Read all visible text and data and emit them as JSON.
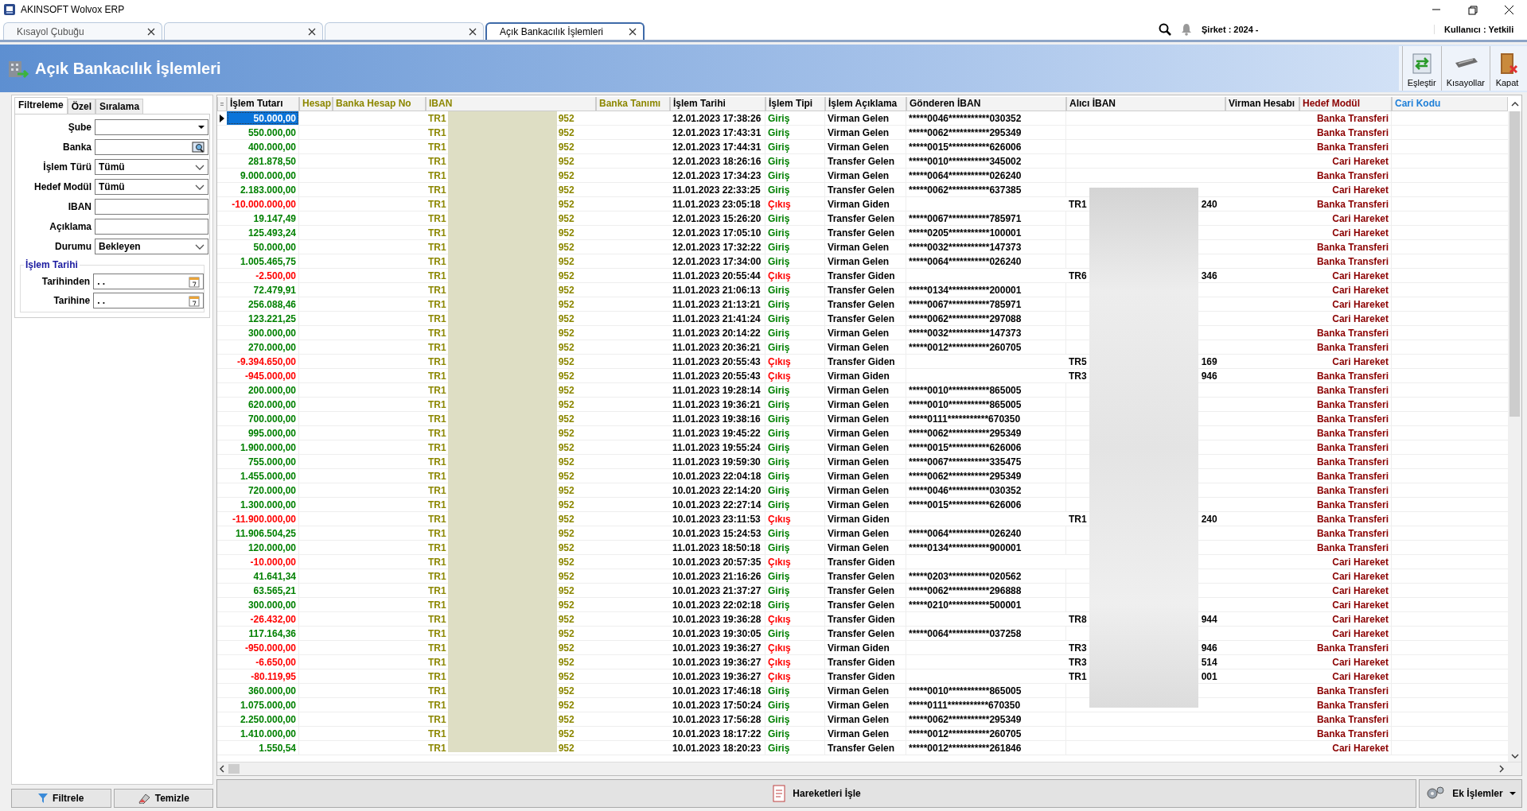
{
  "window": {
    "title": "AKINSOFT Wolvox ERP"
  },
  "tabs": [
    {
      "label": "Kısayol Çubuğu",
      "selected": false
    },
    {
      "selected": false
    },
    {
      "selected": false
    },
    {
      "label": "Açık Bankacılık İşlemleri",
      "selected": true
    }
  ],
  "status": {
    "company": "Şirket : 2024 -",
    "user": "Kullanıcı : Yetkili"
  },
  "page_title": "Açık Bankacılık İşlemleri",
  "toolbar": [
    {
      "label": "Eşleştir",
      "kind": "match"
    },
    {
      "label": "Kısayollar",
      "kind": "keyboard"
    },
    {
      "label": "Kapat",
      "kind": "exit"
    }
  ],
  "filter_tabs": [
    {
      "label": "Filtreleme",
      "selected": true
    },
    {
      "label": "Özel",
      "selected": false
    },
    {
      "label": "Sıralama",
      "selected": false
    }
  ],
  "filters": [
    {
      "label": "Şube",
      "kind": "dropdown"
    },
    {
      "label": "Banka",
      "kind": "lookup"
    },
    {
      "label": "İşlem Türü",
      "kind": "select",
      "value": "Tümü"
    },
    {
      "label": "Hedef Modül",
      "kind": "select",
      "value": "Tümü"
    },
    {
      "label": "IBAN",
      "kind": "text"
    },
    {
      "label": "Açıklama",
      "kind": "text"
    },
    {
      "label": "Durumu",
      "kind": "select",
      "value": "Bekleyen"
    }
  ],
  "date_group": {
    "title": "İşlem Tarihi",
    "fields": [
      {
        "label": "Tarihinden",
        "value": ". ."
      },
      {
        "label": "Tarihine",
        "value": ". ."
      }
    ]
  },
  "filter_buttons": [
    {
      "label": "Filtrele",
      "kind": "filter"
    },
    {
      "label": "Temizle",
      "kind": "clear"
    }
  ],
  "table": {
    "columns": [
      {
        "title": "İşlem Tutarı",
        "color": "#000000"
      },
      {
        "title": "Hesap",
        "color": "#8c8700"
      },
      {
        "title": "Banka Hesap No",
        "color": "#8c8700"
      },
      {
        "title": "IBAN",
        "color": "#8c8700"
      },
      {
        "title": "Banka Tanımı",
        "color": "#8c8700"
      },
      {
        "title": "İşlem Tarihi",
        "color": "#000000"
      },
      {
        "title": "İşlem Tipi",
        "color": "#000000"
      },
      {
        "title": "İşlem Açıklama",
        "color": "#000000"
      },
      {
        "title": "Gönderen İBAN",
        "color": "#000000"
      },
      {
        "title": "Alıcı İBAN",
        "color": "#000000"
      },
      {
        "title": "Virman Hesabı",
        "color": "#000000"
      },
      {
        "title": "Hedef Modül",
        "color": "#8b0000"
      },
      {
        "title": "Cari Kodu",
        "color": "#1e7fd8"
      }
    ],
    "rows": [
      {
        "amount": "50.000,00",
        "kind": "in",
        "selected": true,
        "iban": {
          "start": "TR1",
          "end": "952"
        },
        "date": "12.01.2023 17:38:26",
        "type": "Giriş",
        "desc": "Virman Gelen",
        "sender": "*****0046***********030352",
        "target": "Banka Transferi"
      },
      {
        "amount": "550.000,00",
        "kind": "in",
        "selected": false,
        "iban": {
          "start": "TR1",
          "end": "952"
        },
        "date": "12.01.2023 17:43:31",
        "type": "Giriş",
        "desc": "Virman Gelen",
        "sender": "*****0062***********295349",
        "target": "Banka Transferi"
      },
      {
        "amount": "400.000,00",
        "kind": "in",
        "selected": false,
        "iban": {
          "start": "TR1",
          "end": "952"
        },
        "date": "12.01.2023 17:44:31",
        "type": "Giriş",
        "desc": "Virman Gelen",
        "sender": "*****0015***********626006",
        "target": "Banka Transferi"
      },
      {
        "amount": "281.878,50",
        "kind": "in",
        "selected": false,
        "iban": {
          "start": "TR1",
          "end": "952"
        },
        "date": "12.01.2023 18:26:16",
        "type": "Giriş",
        "desc": "Transfer Gelen",
        "sender": "*****0010***********345002",
        "target": "Cari Hareket"
      },
      {
        "amount": "9.000.000,00",
        "kind": "in",
        "selected": false,
        "iban": {
          "start": "TR1",
          "end": "952"
        },
        "date": "12.01.2023 17:34:23",
        "type": "Giriş",
        "desc": "Virman Gelen",
        "sender": "*****0064***********026240",
        "target": "Banka Transferi"
      },
      {
        "amount": "2.183.000,00",
        "kind": "in",
        "selected": false,
        "iban": {
          "start": "TR1",
          "end": "952"
        },
        "date": "11.01.2023 22:33:25",
        "type": "Giriş",
        "desc": "Transfer Gelen",
        "sender": "*****0062***********637385",
        "target": "Cari Hareket"
      },
      {
        "amount": "-10.000.000,00",
        "kind": "out",
        "selected": false,
        "iban": {
          "start": "TR1",
          "end": "952"
        },
        "date": "11.01.2023 23:05:18",
        "type": "Çıkış",
        "desc": "Virman Giden",
        "receiver": {
          "start": "TR1",
          "end": "240"
        },
        "target": "Banka Transferi"
      },
      {
        "amount": "19.147,49",
        "kind": "in",
        "selected": false,
        "iban": {
          "start": "TR1",
          "end": "952"
        },
        "date": "12.01.2023 15:26:20",
        "type": "Giriş",
        "desc": "Transfer Gelen",
        "sender": "*****0067***********785971",
        "target": "Cari Hareket"
      },
      {
        "amount": "125.493,24",
        "kind": "in",
        "selected": false,
        "iban": {
          "start": "TR1",
          "end": "952"
        },
        "date": "12.01.2023 17:05:10",
        "type": "Giriş",
        "desc": "Transfer Gelen",
        "sender": "*****0205***********100001",
        "target": "Cari Hareket"
      },
      {
        "amount": "50.000,00",
        "kind": "in",
        "selected": false,
        "iban": {
          "start": "TR1",
          "end": "952"
        },
        "date": "12.01.2023 17:32:22",
        "type": "Giriş",
        "desc": "Virman Gelen",
        "sender": "*****0032***********147373",
        "target": "Banka Transferi"
      },
      {
        "amount": "1.005.465,75",
        "kind": "in",
        "selected": false,
        "iban": {
          "start": "TR1",
          "end": "952"
        },
        "date": "12.01.2023 17:34:00",
        "type": "Giriş",
        "desc": "Virman Gelen",
        "sender": "*****0064***********026240",
        "target": "Banka Transferi"
      },
      {
        "amount": "-2.500,00",
        "kind": "out",
        "selected": false,
        "iban": {
          "start": "TR1",
          "end": "952"
        },
        "date": "11.01.2023 20:55:44",
        "type": "Çıkış",
        "desc": "Transfer Giden",
        "receiver": {
          "start": "TR6",
          "end": "346"
        },
        "target": "Cari Hareket"
      },
      {
        "amount": "72.479,91",
        "kind": "in",
        "selected": false,
        "iban": {
          "start": "TR1",
          "end": "952"
        },
        "date": "11.01.2023 21:06:13",
        "type": "Giriş",
        "desc": "Transfer Gelen",
        "sender": "*****0134***********200001",
        "target": "Cari Hareket"
      },
      {
        "amount": "256.088,46",
        "kind": "in",
        "selected": false,
        "iban": {
          "start": "TR1",
          "end": "952"
        },
        "date": "11.01.2023 21:13:21",
        "type": "Giriş",
        "desc": "Transfer Gelen",
        "sender": "*****0067***********785971",
        "target": "Cari Hareket"
      },
      {
        "amount": "123.221,25",
        "kind": "in",
        "selected": false,
        "iban": {
          "start": "TR1",
          "end": "952"
        },
        "date": "11.01.2023 21:41:24",
        "type": "Giriş",
        "desc": "Transfer Gelen",
        "sender": "*****0062***********297088",
        "target": "Cari Hareket"
      },
      {
        "amount": "300.000,00",
        "kind": "in",
        "selected": false,
        "iban": {
          "start": "TR1",
          "end": "952"
        },
        "date": "11.01.2023 20:14:22",
        "type": "Giriş",
        "desc": "Virman Gelen",
        "sender": "*****0032***********147373",
        "target": "Banka Transferi"
      },
      {
        "amount": "270.000,00",
        "kind": "in",
        "selected": false,
        "iban": {
          "start": "TR1",
          "end": "952"
        },
        "date": "11.01.2023 20:36:21",
        "type": "Giriş",
        "desc": "Virman Gelen",
        "sender": "*****0012***********260705",
        "target": "Banka Transferi"
      },
      {
        "amount": "-9.394.650,00",
        "kind": "out",
        "selected": false,
        "iban": {
          "start": "TR1",
          "end": "952"
        },
        "date": "11.01.2023 20:55:43",
        "type": "Çıkış",
        "desc": "Transfer Giden",
        "receiver": {
          "start": "TR5",
          "end": "169"
        },
        "target": "Cari Hareket"
      },
      {
        "amount": "-945.000,00",
        "kind": "out",
        "selected": false,
        "iban": {
          "start": "TR1",
          "end": "952"
        },
        "date": "11.01.2023 20:55:43",
        "type": "Çıkış",
        "desc": "Virman Giden",
        "receiver": {
          "start": "TR3",
          "end": "946"
        },
        "target": "Banka Transferi"
      },
      {
        "amount": "200.000,00",
        "kind": "in",
        "selected": false,
        "iban": {
          "start": "TR1",
          "end": "952"
        },
        "date": "11.01.2023 19:28:14",
        "type": "Giriş",
        "desc": "Virman Gelen",
        "sender": "*****0010***********865005",
        "target": "Banka Transferi"
      },
      {
        "amount": "620.000,00",
        "kind": "in",
        "selected": false,
        "iban": {
          "start": "TR1",
          "end": "952"
        },
        "date": "11.01.2023 19:36:21",
        "type": "Giriş",
        "desc": "Virman Gelen",
        "sender": "*****0010***********865005",
        "target": "Banka Transferi"
      },
      {
        "amount": "700.000,00",
        "kind": "in",
        "selected": false,
        "iban": {
          "start": "TR1",
          "end": "952"
        },
        "date": "11.01.2023 19:38:16",
        "type": "Giriş",
        "desc": "Virman Gelen",
        "sender": "*****0111***********670350",
        "target": "Banka Transferi"
      },
      {
        "amount": "995.000,00",
        "kind": "in",
        "selected": false,
        "iban": {
          "start": "TR1",
          "end": "952"
        },
        "date": "11.01.2023 19:45:22",
        "type": "Giriş",
        "desc": "Virman Gelen",
        "sender": "*****0062***********295349",
        "target": "Banka Transferi"
      },
      {
        "amount": "1.900.000,00",
        "kind": "in",
        "selected": false,
        "iban": {
          "start": "TR1",
          "end": "952"
        },
        "date": "11.01.2023 19:55:24",
        "type": "Giriş",
        "desc": "Virman Gelen",
        "sender": "*****0015***********626006",
        "target": "Banka Transferi"
      },
      {
        "amount": "755.000,00",
        "kind": "in",
        "selected": false,
        "iban": {
          "start": "TR1",
          "end": "952"
        },
        "date": "11.01.2023 19:59:30",
        "type": "Giriş",
        "desc": "Virman Gelen",
        "sender": "*****0067***********335475",
        "target": "Banka Transferi"
      },
      {
        "amount": "1.455.000,00",
        "kind": "in",
        "selected": false,
        "iban": {
          "start": "TR1",
          "end": "952"
        },
        "date": "10.01.2023 22:04:18",
        "type": "Giriş",
        "desc": "Virman Gelen",
        "sender": "*****0062***********295349",
        "target": "Banka Transferi"
      },
      {
        "amount": "720.000,00",
        "kind": "in",
        "selected": false,
        "iban": {
          "start": "TR1",
          "end": "952"
        },
        "date": "10.01.2023 22:14:20",
        "type": "Giriş",
        "desc": "Virman Gelen",
        "sender": "*****0046***********030352",
        "target": "Banka Transferi"
      },
      {
        "amount": "1.300.000,00",
        "kind": "in",
        "selected": false,
        "iban": {
          "start": "TR1",
          "end": "952"
        },
        "date": "10.01.2023 22:27:14",
        "type": "Giriş",
        "desc": "Virman Gelen",
        "sender": "*****0015***********626006",
        "target": "Banka Transferi"
      },
      {
        "amount": "-11.900.000,00",
        "kind": "out",
        "selected": false,
        "iban": {
          "start": "TR1",
          "end": "952"
        },
        "date": "10.01.2023 23:11:53",
        "type": "Çıkış",
        "desc": "Virman Giden",
        "receiver": {
          "start": "TR1",
          "end": "240"
        },
        "target": "Banka Transferi"
      },
      {
        "amount": "11.906.504,25",
        "kind": "in",
        "selected": false,
        "iban": {
          "start": "TR1",
          "end": "952"
        },
        "date": "10.01.2023 15:24:53",
        "type": "Giriş",
        "desc": "Virman Gelen",
        "sender": "*****0064***********026240",
        "target": "Banka Transferi"
      },
      {
        "amount": "120.000,00",
        "kind": "in",
        "selected": false,
        "iban": {
          "start": "TR1",
          "end": "952"
        },
        "date": "11.01.2023 18:50:18",
        "type": "Giriş",
        "desc": "Virman Gelen",
        "sender": "*****0134***********900001",
        "target": "Banka Transferi"
      },
      {
        "amount": "-10.000,00",
        "kind": "out",
        "selected": false,
        "iban": {
          "start": "TR1",
          "end": "952"
        },
        "date": "10.01.2023 20:57:35",
        "type": "Çıkış",
        "desc": "Transfer Giden",
        "target": "Cari Hareket"
      },
      {
        "amount": "41.641,34",
        "kind": "in",
        "selected": false,
        "iban": {
          "start": "TR1",
          "end": "952"
        },
        "date": "10.01.2023 21:16:26",
        "type": "Giriş",
        "desc": "Transfer Gelen",
        "sender": "*****0203***********020562",
        "target": "Cari Hareket"
      },
      {
        "amount": "63.565,21",
        "kind": "in",
        "selected": false,
        "iban": {
          "start": "TR1",
          "end": "952"
        },
        "date": "10.01.2023 21:37:27",
        "type": "Giriş",
        "desc": "Transfer Gelen",
        "sender": "*****0062***********296888",
        "target": "Cari Hareket"
      },
      {
        "amount": "300.000,00",
        "kind": "in",
        "selected": false,
        "iban": {
          "start": "TR1",
          "end": "952"
        },
        "date": "10.01.2023 22:02:18",
        "type": "Giriş",
        "desc": "Transfer Gelen",
        "sender": "*****0210***********500001",
        "target": "Cari Hareket"
      },
      {
        "amount": "-26.432,00",
        "kind": "out",
        "selected": false,
        "iban": {
          "start": "TR1",
          "end": "952"
        },
        "date": "10.01.2023 19:36:28",
        "type": "Çıkış",
        "desc": "Transfer Giden",
        "receiver": {
          "start": "TR8",
          "end": "944"
        },
        "target": "Cari Hareket"
      },
      {
        "amount": "117.164,36",
        "kind": "in",
        "selected": false,
        "iban": {
          "start": "TR1",
          "end": "952"
        },
        "date": "10.01.2023 19:30:05",
        "type": "Giriş",
        "desc": "Transfer Gelen",
        "sender": "*****0064***********037258",
        "target": "Cari Hareket"
      },
      {
        "amount": "-950.000,00",
        "kind": "out",
        "selected": false,
        "iban": {
          "start": "TR1",
          "end": "952"
        },
        "date": "10.01.2023 19:36:27",
        "type": "Çıkış",
        "desc": "Virman Giden",
        "receiver": {
          "start": "TR3",
          "end": "946"
        },
        "target": "Banka Transferi"
      },
      {
        "amount": "-6.650,00",
        "kind": "out",
        "selected": false,
        "iban": {
          "start": "TR1",
          "end": "952"
        },
        "date": "10.01.2023 19:36:27",
        "type": "Çıkış",
        "desc": "Transfer Giden",
        "receiver": {
          "start": "TR3",
          "end": "514"
        },
        "target": "Cari Hareket"
      },
      {
        "amount": "-80.119,95",
        "kind": "out",
        "selected": false,
        "iban": {
          "start": "TR1",
          "end": "952"
        },
        "date": "10.01.2023 19:36:27",
        "type": "Çıkış",
        "desc": "Transfer Giden",
        "receiver": {
          "start": "TR1",
          "end": "001"
        },
        "target": "Cari Hareket"
      },
      {
        "amount": "360.000,00",
        "kind": "in",
        "selected": false,
        "iban": {
          "start": "TR1",
          "end": "952"
        },
        "date": "10.01.2023 17:46:18",
        "type": "Giriş",
        "desc": "Virman Gelen",
        "sender": "*****0010***********865005",
        "target": "Banka Transferi"
      },
      {
        "amount": "1.075.000,00",
        "kind": "in",
        "selected": false,
        "iban": {
          "start": "TR1",
          "end": "952"
        },
        "date": "10.01.2023 17:50:24",
        "type": "Giriş",
        "desc": "Virman Gelen",
        "sender": "*****0111***********670350",
        "target": "Banka Transferi"
      },
      {
        "amount": "2.250.000,00",
        "kind": "in",
        "selected": false,
        "iban": {
          "start": "TR1",
          "end": "952"
        },
        "date": "10.01.2023 17:56:28",
        "type": "Giriş",
        "desc": "Virman Gelen",
        "sender": "*****0062***********295349",
        "target": "Banka Transferi"
      },
      {
        "amount": "1.410.000,00",
        "kind": "in",
        "selected": false,
        "iban": {
          "start": "TR1",
          "end": "952"
        },
        "date": "10.01.2023 18:17:22",
        "type": "Giriş",
        "desc": "Virman Gelen",
        "sender": "*****0012***********260705",
        "target": "Banka Transferi"
      },
      {
        "amount": "1.550,54",
        "kind": "in",
        "selected": false,
        "iban": {
          "start": "TR1",
          "end": "952"
        },
        "date": "10.01.2023 18:20:23",
        "type": "Giriş",
        "desc": "Transfer Gelen",
        "sender": "*****0012***********261846",
        "target": "Cari Hareket"
      }
    ]
  },
  "actions": [
    {
      "label": "Hareketleri İşle",
      "kind": "process"
    },
    {
      "label": "Ek İşlemler",
      "kind": "more"
    }
  ]
}
